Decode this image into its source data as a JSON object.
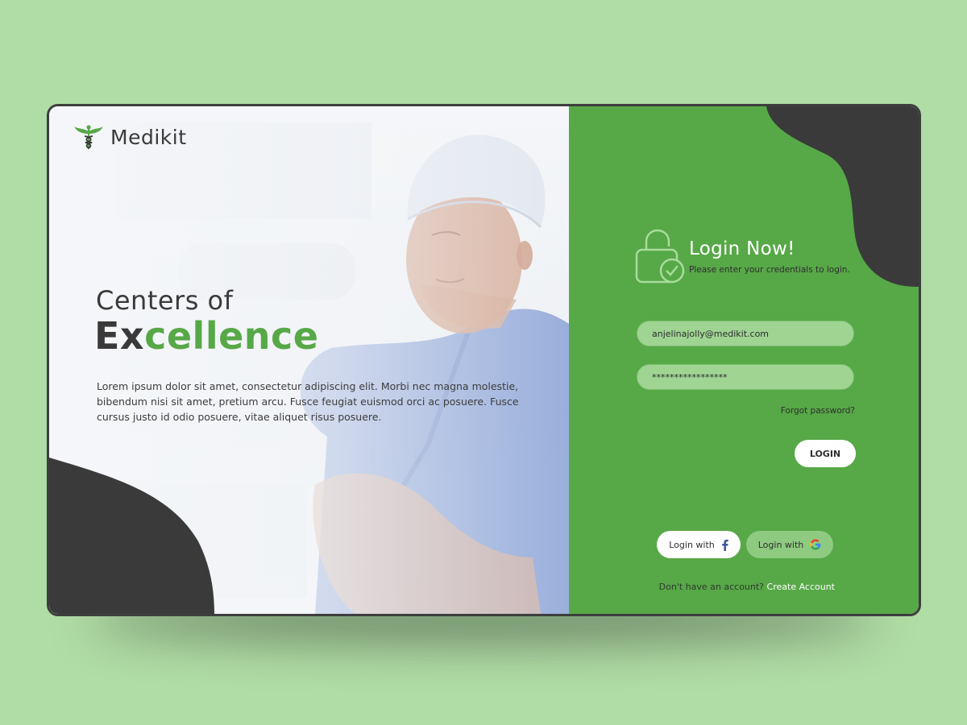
{
  "brand": {
    "name": "Medikit"
  },
  "hero": {
    "line1": "Centers of",
    "line2_dark": "Ex",
    "line2_green": "cellence",
    "description": "Lorem ipsum dolor sit amet, consectetur adipiscing elit. Morbi nec magna molestie, bibendum nisi sit amet, pretium arcu. Fusce feugiat euismod orci ac posuere. Fusce cursus justo id odio posuere, vitae aliquet risus posuere."
  },
  "login": {
    "title": "Login Now!",
    "subtitle": "Please enter your credentials to login.",
    "email_value": "anjelinajolly@medikit.com",
    "password_value": "*****************",
    "forgot_label": "Forgot password?",
    "login_button": "LOGIN",
    "social": {
      "facebook_label": "Login with",
      "google_label": "Login with"
    },
    "signup_prompt": "Don't have an account?",
    "signup_link": "Create Account"
  },
  "colors": {
    "background": "#b0dca5",
    "accent_green": "#57a847",
    "dark": "#3a3a3a",
    "white": "#ffffff"
  },
  "icons": [
    "caduceus-icon",
    "lock-check-icon",
    "facebook-icon",
    "google-icon"
  ]
}
